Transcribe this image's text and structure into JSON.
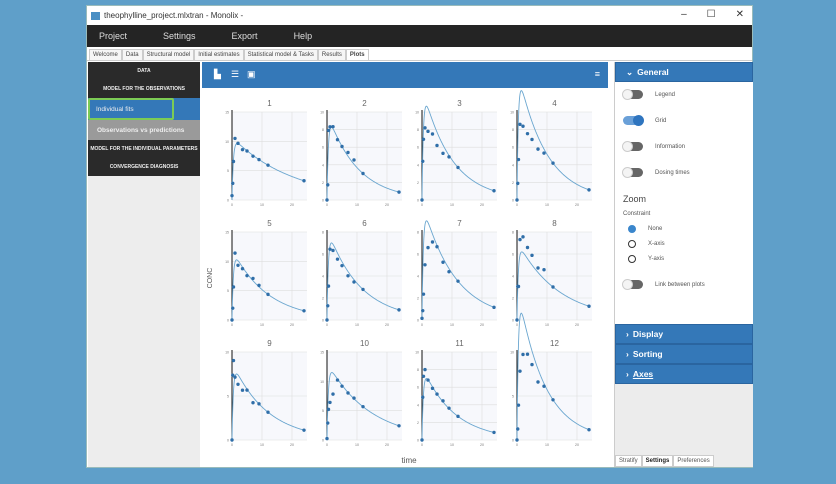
{
  "window": {
    "title": "theophylline_project.mlxtran - Monolix -",
    "minimize": "–",
    "maximize": "☐",
    "close": "✕"
  },
  "menu": [
    "Project",
    "Settings",
    "Export",
    "Help"
  ],
  "tabs": [
    "Welcome",
    "Data",
    "Structural model",
    "Initial estimates",
    "Statistical model & Tasks",
    "Results",
    "Plots"
  ],
  "nav": {
    "data": "DATA",
    "model_obs": "MODEL FOR THE OBSERVATIONS",
    "individual_fits": "Individual fits",
    "obs_vs_pred": "Observations vs predictions",
    "model_indiv": "MODEL FOR THE INDIVIDUAL PARAMETERS",
    "convergence": "CONVERGENCE DIAGNOSIS"
  },
  "toolbar": {
    "chart_icon": "bar-chart-icon",
    "list_icon": "list-icon",
    "save_icon": "save-icon",
    "menu_icon": "hamburger-icon"
  },
  "settings": {
    "general": "General",
    "legend": "Legend",
    "grid": "Grid",
    "information": "Information",
    "dosing_times": "Dosing times",
    "zoom": "Zoom",
    "constraint": "Constraint",
    "none": "None",
    "x_axis": "X-axis",
    "y_axis": "Y-axis",
    "link": "Link between plots",
    "display": "Display",
    "sorting": "Sorting",
    "axes": "Axes",
    "toggles": {
      "legend": false,
      "grid": true,
      "information": false,
      "dosing_times": false,
      "link": false
    },
    "constraint_selected": "None"
  },
  "bottom_tabs": [
    "Stratify",
    "Settings",
    "Preferences"
  ],
  "chart_data": {
    "type": "scatter",
    "xlabel": "time",
    "ylabel": "CONC",
    "xlim": [
      0,
      25
    ],
    "xticks": [
      0,
      10,
      20
    ],
    "times": [
      0,
      0.25,
      0.5,
      1,
      2,
      3.5,
      5,
      7,
      9,
      12,
      24
    ],
    "subjects": [
      {
        "id": "1",
        "obs": [
          0.74,
          2.84,
          6.57,
          10.5,
          9.66,
          8.58,
          8.36,
          7.47,
          6.89,
          5.94,
          3.28
        ]
      },
      {
        "id": "2",
        "obs": [
          0,
          1.72,
          7.91,
          8.31,
          8.33,
          6.85,
          6.08,
          5.4,
          4.55,
          3.01,
          0.9
        ]
      },
      {
        "id": "3",
        "obs": [
          0,
          4.4,
          6.9,
          8.2,
          7.8,
          7.5,
          6.2,
          5.3,
          4.9,
          3.7,
          1.05
        ]
      },
      {
        "id": "4",
        "obs": [
          0,
          1.89,
          4.6,
          8.6,
          8.38,
          7.54,
          6.88,
          5.78,
          5.33,
          4.19,
          1.15
        ]
      },
      {
        "id": "5",
        "obs": [
          0,
          2.02,
          5.63,
          11.4,
          9.33,
          8.74,
          7.56,
          7.09,
          5.9,
          4.37,
          1.57
        ]
      },
      {
        "id": "6",
        "obs": [
          0,
          1.29,
          3.08,
          6.44,
          6.32,
          5.53,
          4.94,
          4.02,
          3.46,
          2.78,
          0.92
        ]
      },
      {
        "id": "7",
        "obs": [
          0.15,
          0.85,
          2.35,
          5.02,
          6.58,
          7.09,
          6.66,
          5.25,
          4.39,
          3.53,
          1.15
        ]
      },
      {
        "id": "8",
        "obs": [
          0,
          3.05,
          3.05,
          7.31,
          7.56,
          6.59,
          5.88,
          4.73,
          4.57,
          3.0,
          1.25
        ]
      },
      {
        "id": "9",
        "obs": [
          0,
          7.37,
          9.03,
          7.14,
          6.33,
          5.66,
          5.67,
          4.24,
          4.11,
          3.16,
          1.12
        ]
      },
      {
        "id": "10",
        "obs": [
          0.24,
          2.89,
          5.22,
          6.41,
          7.83,
          10.21,
          9.18,
          8.02,
          7.14,
          5.68,
          2.42
        ]
      },
      {
        "id": "11",
        "obs": [
          0,
          4.86,
          7.24,
          8.0,
          6.81,
          5.87,
          5.22,
          4.45,
          3.62,
          2.69,
          0.86
        ]
      },
      {
        "id": "12",
        "obs": [
          0,
          1.25,
          3.96,
          7.82,
          9.72,
          9.75,
          8.57,
          6.59,
          6.11,
          4.57,
          1.17
        ]
      }
    ]
  }
}
